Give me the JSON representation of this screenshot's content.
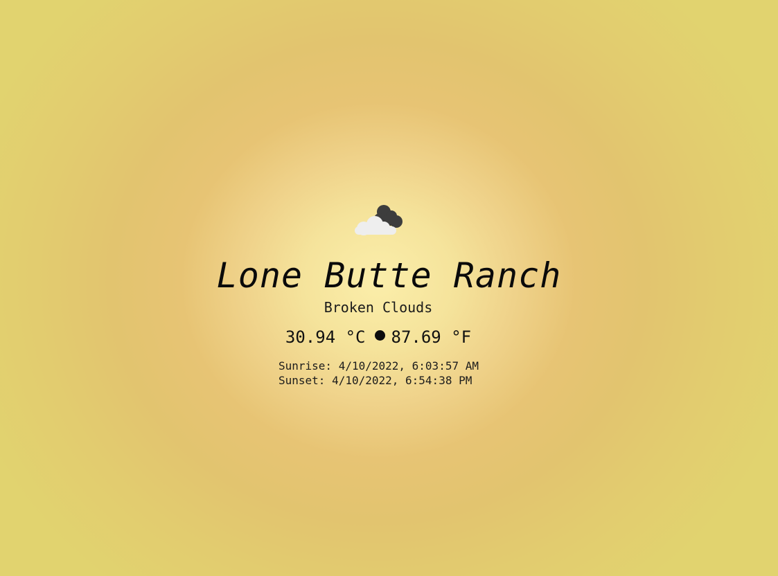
{
  "weather": {
    "icon": "broken-clouds-icon",
    "city": "Lone Butte Ranch",
    "description": "Broken Clouds",
    "temp_c": "30.94 °C",
    "temp_f": "87.69 °F",
    "sunrise": "Sunrise: 4/10/2022, 6:03:57 AM",
    "sunset": "Sunset: 4/10/2022, 6:54:38 PM"
  },
  "colors": {
    "background_center": "#fbeeaa",
    "background_edge": "#e1d36f",
    "text": "#111111",
    "cloud_dark": "#3d3d3d",
    "cloud_light": "#eeeeee"
  }
}
